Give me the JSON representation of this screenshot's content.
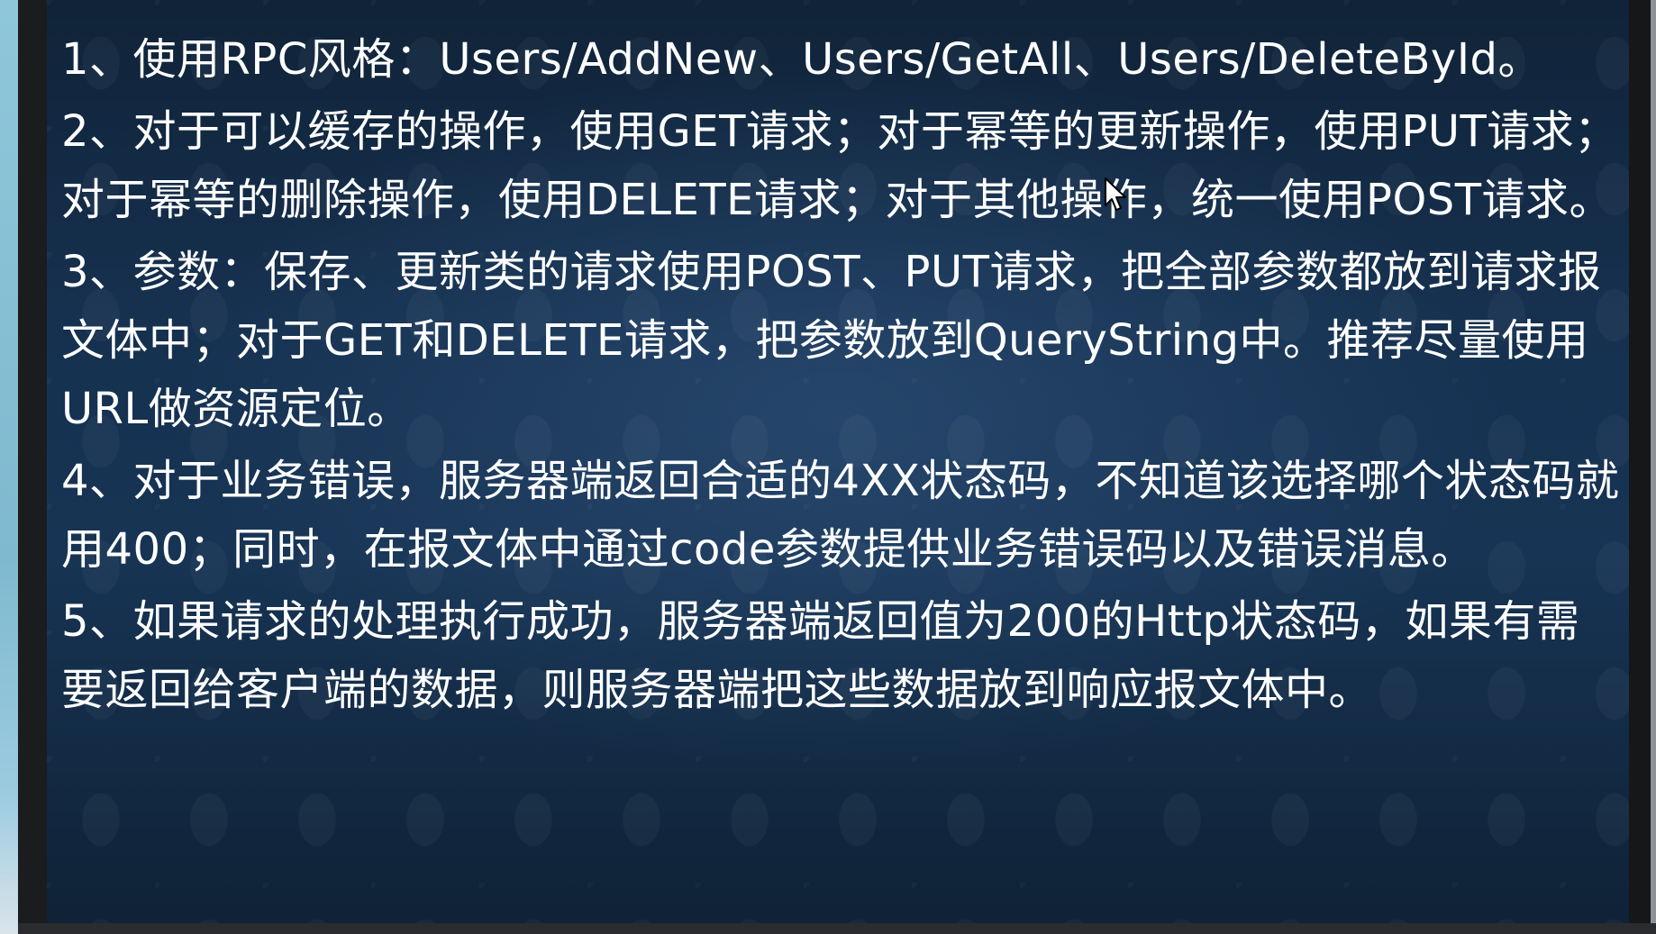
{
  "slide": {
    "paragraphs": [
      "1、使用RPC风格：Users/AddNew、Users/GetAll、Users/DeleteById。",
      "2、对于可以缓存的操作，使用GET请求；对于幂等的更新操作，使用PUT请求；对于幂等的删除操作，使用DELETE请求；对于其他操作，统一使用POST请求。",
      "3、参数：保存、更新类的请求使用POST、PUT请求，把全部参数都放到请求报文体中；对于GET和DELETE请求，把参数放到QueryString中。推荐尽量使用URL做资源定位。",
      "4、对于业务错误，服务器端返回合适的4XX状态码，不知道该选择哪个状态码就用400；同时，在报文体中通过code参数提供业务错误码以及错误消息。",
      "5、如果请求的处理执行成功，服务器端返回值为200的Http状态码，如果有需要返回给客户端的数据，则服务器端把这些数据放到响应报文体中。"
    ]
  },
  "icons": {
    "cursor": "mouse-pointer-icon"
  },
  "colors": {
    "text": "#ffffff",
    "slide_background": "#163150",
    "bezel": "#1a1c1e"
  }
}
